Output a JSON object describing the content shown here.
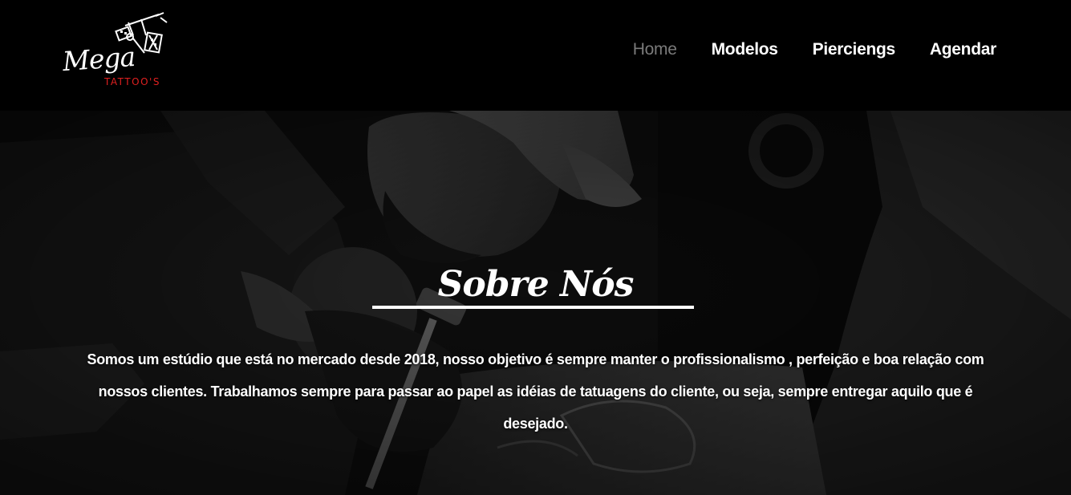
{
  "brand": {
    "logo_script": "Mega",
    "logo_sub": "TATTOO'S"
  },
  "nav": {
    "items": [
      {
        "label": "Home",
        "active": true
      },
      {
        "label": "Modelos",
        "active": false
      },
      {
        "label": "Pierciengs",
        "active": false
      },
      {
        "label": "Agendar",
        "active": false
      }
    ]
  },
  "hero": {
    "title": "Sobre Nós",
    "text": "Somos um estúdio que está no mercado desde 2018, nosso objetivo é sempre manter o profissionalismo , perfeição e boa relação com nossos clientes. Trabalhamos sempre para passar ao papel as idéias de tatuagens do cliente, ou seja, sempre entregar aquilo que é desejado."
  },
  "colors": {
    "background": "#000000",
    "nav_active": "#7a7a7a",
    "nav_text": "#ffffff",
    "logo_accent": "#e02020"
  },
  "icons": {
    "logo_graphic": "tattoo-machine-icon"
  }
}
